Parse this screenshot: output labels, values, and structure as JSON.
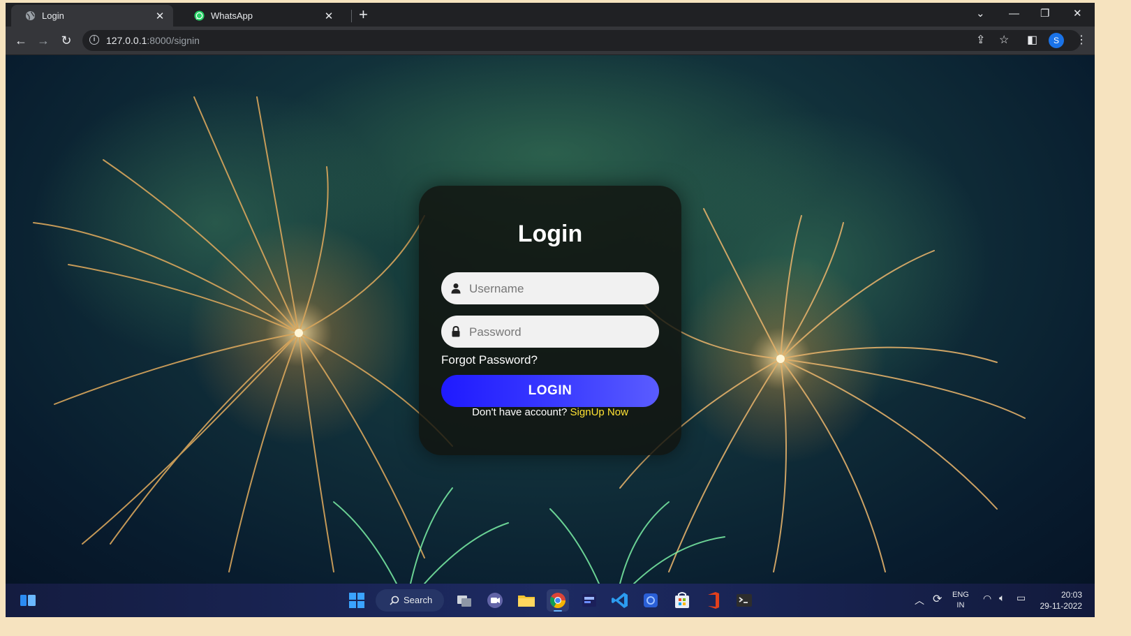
{
  "browser": {
    "tabs": [
      {
        "title": "Login",
        "icon": "globe-icon",
        "active": true
      },
      {
        "title": "WhatsApp",
        "icon": "whatsapp-icon",
        "active": false
      }
    ],
    "new_tab_symbol": "+",
    "url_host": "127.0.0.1",
    "url_rest": ":8000/signin",
    "profile_initial": "S"
  },
  "login_form": {
    "title": "Login",
    "username_placeholder": "Username",
    "password_placeholder": "Password",
    "forgot_password": "Forgot Password?",
    "login_button": "LOGIN",
    "signup_prompt": "Don't have account?",
    "signup_link": "SignUp Now"
  },
  "taskbar": {
    "search_label": "Search",
    "apps": [
      "start-icon",
      "search-icon",
      "task-view-icon",
      "teams-chat-icon",
      "file-explorer-icon",
      "chrome-icon",
      "devhome-icon",
      "vscode-icon",
      "security-icon",
      "microsoft-store-icon",
      "office-icon",
      "terminal-icon"
    ],
    "language_line1": "ENG",
    "language_line2": "IN",
    "time": "20:03",
    "date": "29-11-2022"
  },
  "colors": {
    "login_button": "#2a1cff",
    "signup_link": "#ffe234",
    "card_bg": "#121410"
  }
}
